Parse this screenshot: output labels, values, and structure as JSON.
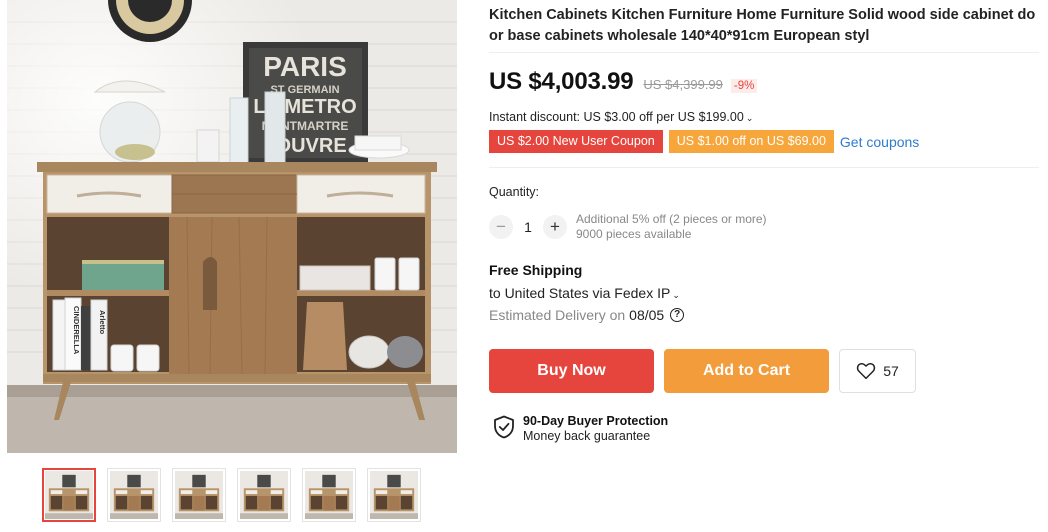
{
  "product": {
    "title": "Kitchen Cabinets Kitchen Furniture Home Furniture Solid wood side cabinet door base cabinets wholesale 140*40*91cm European styl"
  },
  "poster": {
    "line1": "PARIS",
    "line2": "ST GERMAIN",
    "line3": "LE METRO",
    "line4": "MONTMARTRE",
    "line5": "LOUVRE"
  },
  "books": [
    "CINDERELLA",
    "Arletto"
  ],
  "price": {
    "current": "US $4,003.99",
    "original": "US $4,399.99",
    "discount": "-9%"
  },
  "instant_discount": {
    "text": "Instant discount: US $3.00 off per US $199.00",
    "chevron": "⌄"
  },
  "coupons": {
    "items": [
      "US $2.00 New User Coupon",
      "US $1.00 off on US $69.00"
    ],
    "get_label": "Get coupons"
  },
  "quantity": {
    "label": "Quantity:",
    "minus": "−",
    "value": "1",
    "plus": "+",
    "note1": "Additional 5% off (2 pieces or more)",
    "note2": "9000 pieces available"
  },
  "shipping": {
    "title": "Free Shipping",
    "to": "to United States via Fedex IP",
    "chevron": "⌄",
    "delivery_label": "Estimated Delivery on",
    "delivery_date": "08/05",
    "help": "?"
  },
  "actions": {
    "buy_now": "Buy Now",
    "add_to_cart": "Add to Cart",
    "wishlist_count": "57"
  },
  "protection": {
    "title": "90-Day Buyer Protection",
    "subtitle": "Money back guarantee"
  },
  "icons": {
    "heart": "heart-icon",
    "shield": "shield-check-icon",
    "help": "question-circle-icon"
  },
  "colors": {
    "accent_red": "#e6453d",
    "accent_orange": "#f39c3c",
    "link_blue": "#2e7bcf"
  }
}
